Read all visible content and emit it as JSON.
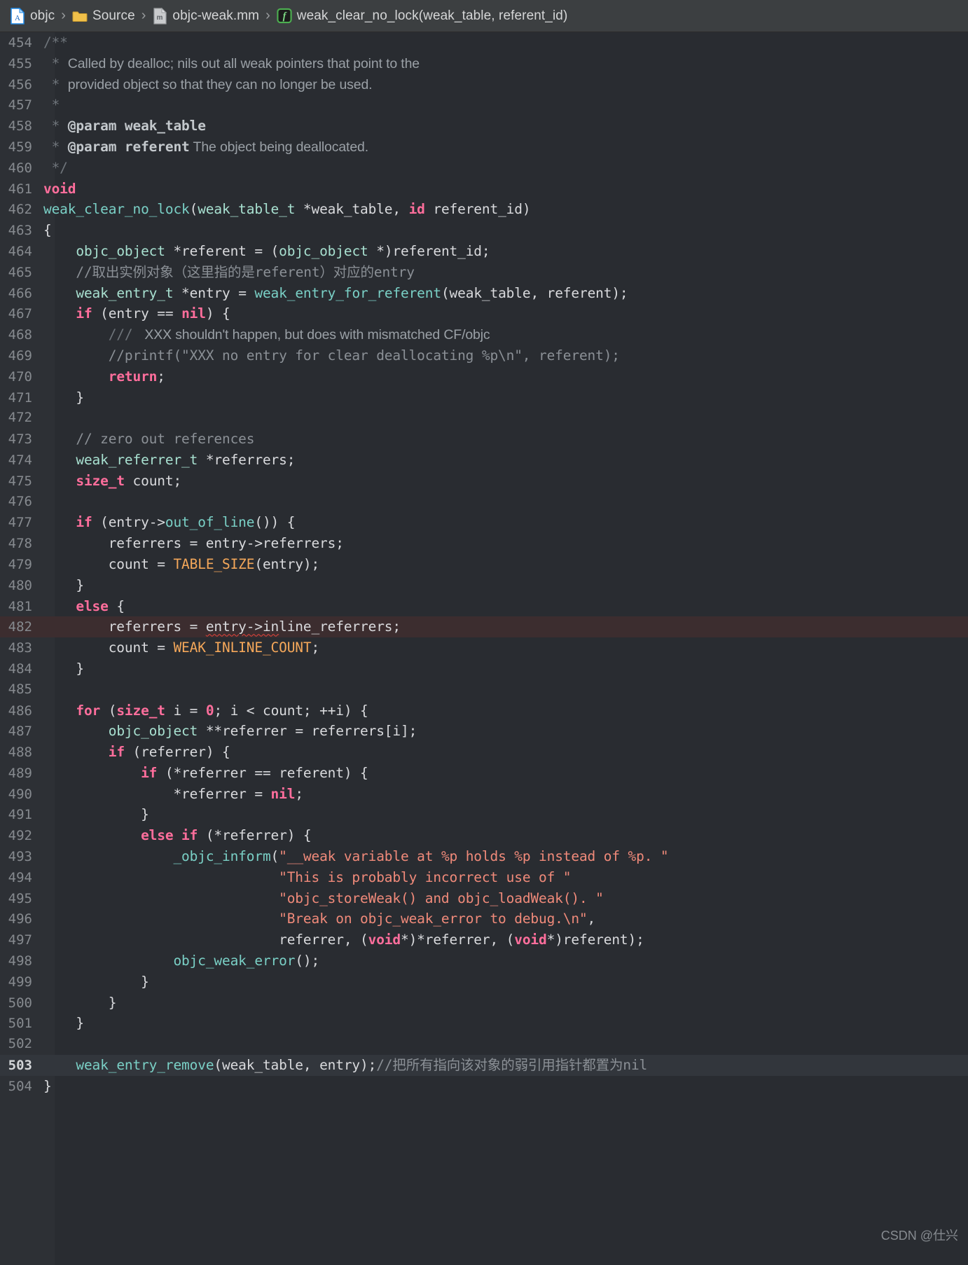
{
  "breadcrumb": {
    "items": [
      {
        "icon": "objc-project-file-icon",
        "label": "objc"
      },
      {
        "icon": "folder-icon",
        "label": "Source"
      },
      {
        "icon": "objective-c-file-icon",
        "label": "objc-weak.mm"
      },
      {
        "icon": "function-symbol-icon",
        "label": "weak_clear_no_lock(weak_table, referent_id)"
      }
    ],
    "separator": "›"
  },
  "watermark": "CSDN @仕兴",
  "colors": {
    "editor_background": "#292c31",
    "gutter_background": "#2d3035",
    "breadcrumb_background": "#3c3f41",
    "error_line_background": "#3c2d2f",
    "caret_line_background": "#32363c",
    "keyword": "#ff6e9c",
    "function": "#7ad0c6",
    "type": "#a8e0d0",
    "string": "#f08a7a",
    "macro": "#f5a85a",
    "comment": "#8b9096",
    "error_underline": "#e8453c"
  },
  "editor": {
    "lines": [
      {
        "num": "454",
        "segments": [
          {
            "t": "/**",
            "c": "cmtdoc-dim"
          }
        ]
      },
      {
        "num": "455",
        "segments": [
          {
            "t": " * ",
            "c": "cmtdoc-dim"
          },
          {
            "t": "Called by dealloc; nils out all weak pointers that point to the",
            "c": "cmtdoc"
          }
        ]
      },
      {
        "num": "456",
        "segments": [
          {
            "t": " * ",
            "c": "cmtdoc-dim"
          },
          {
            "t": "provided object so that they can no longer be used.",
            "c": "cmtdoc"
          }
        ]
      },
      {
        "num": "457",
        "segments": [
          {
            "t": " *",
            "c": "cmtdoc-dim"
          }
        ]
      },
      {
        "num": "458",
        "segments": [
          {
            "t": " * ",
            "c": "cmtdoc-dim"
          },
          {
            "t": "@param",
            "c": "cmtbold"
          },
          {
            "t": " weak_table",
            "c": "cmtbold"
          }
        ]
      },
      {
        "num": "459",
        "segments": [
          {
            "t": " * ",
            "c": "cmtdoc-dim"
          },
          {
            "t": "@param referent",
            "c": "cmtbold"
          },
          {
            "t": " The object being deallocated.",
            "c": "cmtdoc"
          }
        ]
      },
      {
        "num": "460",
        "segments": [
          {
            "t": " */",
            "c": "cmtdoc-dim"
          }
        ]
      },
      {
        "num": "461",
        "segments": [
          {
            "t": "void",
            "c": "kw"
          }
        ]
      },
      {
        "num": "462",
        "segments": [
          {
            "t": "weak_clear_no_lock",
            "c": "fn"
          },
          {
            "t": "(",
            "c": "plain"
          },
          {
            "t": "weak_table_t",
            "c": "type"
          },
          {
            "t": " *weak_table, ",
            "c": "plain"
          },
          {
            "t": "id",
            "c": "kw"
          },
          {
            "t": " referent_id)",
            "c": "plain"
          }
        ]
      },
      {
        "num": "463",
        "segments": [
          {
            "t": "{",
            "c": "plain"
          }
        ]
      },
      {
        "num": "464",
        "segments": [
          {
            "t": "    ",
            "c": "plain"
          },
          {
            "t": "objc_object",
            "c": "type"
          },
          {
            "t": " *referent = (",
            "c": "plain"
          },
          {
            "t": "objc_object",
            "c": "type"
          },
          {
            "t": " *)referent_id;",
            "c": "plain"
          }
        ]
      },
      {
        "num": "465",
        "segments": [
          {
            "t": "    //取出实例对象（这里指的是referent）对应的entry",
            "c": "cmtcn"
          }
        ]
      },
      {
        "num": "466",
        "segments": [
          {
            "t": "    ",
            "c": "plain"
          },
          {
            "t": "weak_entry_t",
            "c": "type"
          },
          {
            "t": " *entry = ",
            "c": "plain"
          },
          {
            "t": "weak_entry_for_referent",
            "c": "fn"
          },
          {
            "t": "(weak_table, referent);",
            "c": "plain"
          }
        ]
      },
      {
        "num": "467",
        "segments": [
          {
            "t": "    ",
            "c": "plain"
          },
          {
            "t": "if",
            "c": "kw"
          },
          {
            "t": " (entry == ",
            "c": "plain"
          },
          {
            "t": "nil",
            "c": "kw"
          },
          {
            "t": ") {",
            "c": "plain"
          }
        ]
      },
      {
        "num": "468",
        "segments": [
          {
            "t": "        /// ",
            "c": "cmtdoc-dim"
          },
          {
            "t": " XXX shouldn't happen, but does with mismatched CF/objc",
            "c": "cmtdoc"
          }
        ]
      },
      {
        "num": "469",
        "segments": [
          {
            "t": "        //printf(\"XXX no entry for clear deallocating %p\\n\", referent);",
            "c": "cmt"
          }
        ]
      },
      {
        "num": "470",
        "segments": [
          {
            "t": "        ",
            "c": "plain"
          },
          {
            "t": "return",
            "c": "kw"
          },
          {
            "t": ";",
            "c": "plain"
          }
        ]
      },
      {
        "num": "471",
        "segments": [
          {
            "t": "    }",
            "c": "plain"
          }
        ]
      },
      {
        "num": "472",
        "segments": []
      },
      {
        "num": "473",
        "segments": [
          {
            "t": "    // zero out references",
            "c": "cmt"
          }
        ]
      },
      {
        "num": "474",
        "segments": [
          {
            "t": "    ",
            "c": "plain"
          },
          {
            "t": "weak_referrer_t",
            "c": "type"
          },
          {
            "t": " *referrers;",
            "c": "plain"
          }
        ]
      },
      {
        "num": "475",
        "segments": [
          {
            "t": "    ",
            "c": "plain"
          },
          {
            "t": "size_t",
            "c": "kw"
          },
          {
            "t": " count;",
            "c": "plain"
          }
        ]
      },
      {
        "num": "476",
        "segments": []
      },
      {
        "num": "477",
        "segments": [
          {
            "t": "    ",
            "c": "plain"
          },
          {
            "t": "if",
            "c": "kw"
          },
          {
            "t": " (entry->",
            "c": "plain"
          },
          {
            "t": "out_of_line",
            "c": "fn"
          },
          {
            "t": "()) {",
            "c": "plain"
          }
        ]
      },
      {
        "num": "478",
        "segments": [
          {
            "t": "        referrers = entry->referrers;",
            "c": "plain"
          }
        ]
      },
      {
        "num": "479",
        "segments": [
          {
            "t": "        count = ",
            "c": "plain"
          },
          {
            "t": "TABLE_SIZE",
            "c": "mac"
          },
          {
            "t": "(entry);",
            "c": "plain"
          }
        ]
      },
      {
        "num": "480",
        "segments": [
          {
            "t": "    }",
            "c": "plain"
          }
        ]
      },
      {
        "num": "481",
        "segments": [
          {
            "t": "    ",
            "c": "plain"
          },
          {
            "t": "else",
            "c": "kw"
          },
          {
            "t": " {",
            "c": "plain"
          }
        ]
      },
      {
        "num": "482",
        "highlight": "error",
        "segments": [
          {
            "t": "        referrers = ",
            "c": "plain"
          },
          {
            "t": "entry->in",
            "c": "plain err-underline"
          },
          {
            "t": "line_referrers;",
            "c": "plain"
          }
        ]
      },
      {
        "num": "483",
        "segments": [
          {
            "t": "        count = ",
            "c": "plain"
          },
          {
            "t": "WEAK_INLINE_COUNT",
            "c": "mac"
          },
          {
            "t": ";",
            "c": "plain"
          }
        ]
      },
      {
        "num": "484",
        "segments": [
          {
            "t": "    }",
            "c": "plain"
          }
        ]
      },
      {
        "num": "485",
        "segments": []
      },
      {
        "num": "486",
        "segments": [
          {
            "t": "    ",
            "c": "plain"
          },
          {
            "t": "for",
            "c": "kw"
          },
          {
            "t": " (",
            "c": "plain"
          },
          {
            "t": "size_t",
            "c": "kw"
          },
          {
            "t": " i = ",
            "c": "plain"
          },
          {
            "t": "0",
            "c": "kw"
          },
          {
            "t": "; i < count; ++i) {",
            "c": "plain"
          }
        ]
      },
      {
        "num": "487",
        "segments": [
          {
            "t": "        ",
            "c": "plain"
          },
          {
            "t": "objc_object",
            "c": "type"
          },
          {
            "t": " **referrer = referrers[i];",
            "c": "plain"
          }
        ]
      },
      {
        "num": "488",
        "segments": [
          {
            "t": "        ",
            "c": "plain"
          },
          {
            "t": "if",
            "c": "kw"
          },
          {
            "t": " (referrer) {",
            "c": "plain"
          }
        ]
      },
      {
        "num": "489",
        "segments": [
          {
            "t": "            ",
            "c": "plain"
          },
          {
            "t": "if",
            "c": "kw"
          },
          {
            "t": " (*referrer == referent) {",
            "c": "plain"
          }
        ]
      },
      {
        "num": "490",
        "segments": [
          {
            "t": "                *referrer = ",
            "c": "plain"
          },
          {
            "t": "nil",
            "c": "kw"
          },
          {
            "t": ";",
            "c": "plain"
          }
        ]
      },
      {
        "num": "491",
        "segments": [
          {
            "t": "            }",
            "c": "plain"
          }
        ]
      },
      {
        "num": "492",
        "segments": [
          {
            "t": "            ",
            "c": "plain"
          },
          {
            "t": "else if",
            "c": "kw"
          },
          {
            "t": " (*referrer) {",
            "c": "plain"
          }
        ]
      },
      {
        "num": "493",
        "segments": [
          {
            "t": "                ",
            "c": "plain"
          },
          {
            "t": "_objc_inform",
            "c": "fn"
          },
          {
            "t": "(",
            "c": "plain"
          },
          {
            "t": "\"__weak variable at %p holds %p instead of %p. \"",
            "c": "str"
          }
        ]
      },
      {
        "num": "494",
        "segments": [
          {
            "t": "                             ",
            "c": "plain"
          },
          {
            "t": "\"This is probably incorrect use of \"",
            "c": "str"
          }
        ]
      },
      {
        "num": "495",
        "segments": [
          {
            "t": "                             ",
            "c": "plain"
          },
          {
            "t": "\"objc_storeWeak() and objc_loadWeak(). \"",
            "c": "str"
          }
        ]
      },
      {
        "num": "496",
        "segments": [
          {
            "t": "                             ",
            "c": "plain"
          },
          {
            "t": "\"Break on objc_weak_error to debug.\\n\"",
            "c": "str"
          },
          {
            "t": ",",
            "c": "plain"
          }
        ]
      },
      {
        "num": "497",
        "segments": [
          {
            "t": "                             referrer, (",
            "c": "plain"
          },
          {
            "t": "void",
            "c": "kw"
          },
          {
            "t": "*)*referrer, (",
            "c": "plain"
          },
          {
            "t": "void",
            "c": "kw"
          },
          {
            "t": "*)referent);",
            "c": "plain"
          }
        ]
      },
      {
        "num": "498",
        "segments": [
          {
            "t": "                ",
            "c": "plain"
          },
          {
            "t": "objc_weak_error",
            "c": "fn"
          },
          {
            "t": "();",
            "c": "plain"
          }
        ]
      },
      {
        "num": "499",
        "segments": [
          {
            "t": "            }",
            "c": "plain"
          }
        ]
      },
      {
        "num": "500",
        "segments": [
          {
            "t": "        }",
            "c": "plain"
          }
        ]
      },
      {
        "num": "501",
        "segments": [
          {
            "t": "    }",
            "c": "plain"
          }
        ]
      },
      {
        "num": "502",
        "segments": []
      },
      {
        "num": "503",
        "highlight": "caret",
        "current": true,
        "segments": [
          {
            "t": "    ",
            "c": "plain"
          },
          {
            "t": "weak_entry_remove",
            "c": "fn"
          },
          {
            "t": "(weak_table, entry);",
            "c": "plain"
          },
          {
            "t": "//把所有指向该对象的弱引用指针都置为nil",
            "c": "cmt"
          }
        ]
      },
      {
        "num": "504",
        "segments": [
          {
            "t": "}",
            "c": "plain"
          }
        ]
      }
    ]
  }
}
